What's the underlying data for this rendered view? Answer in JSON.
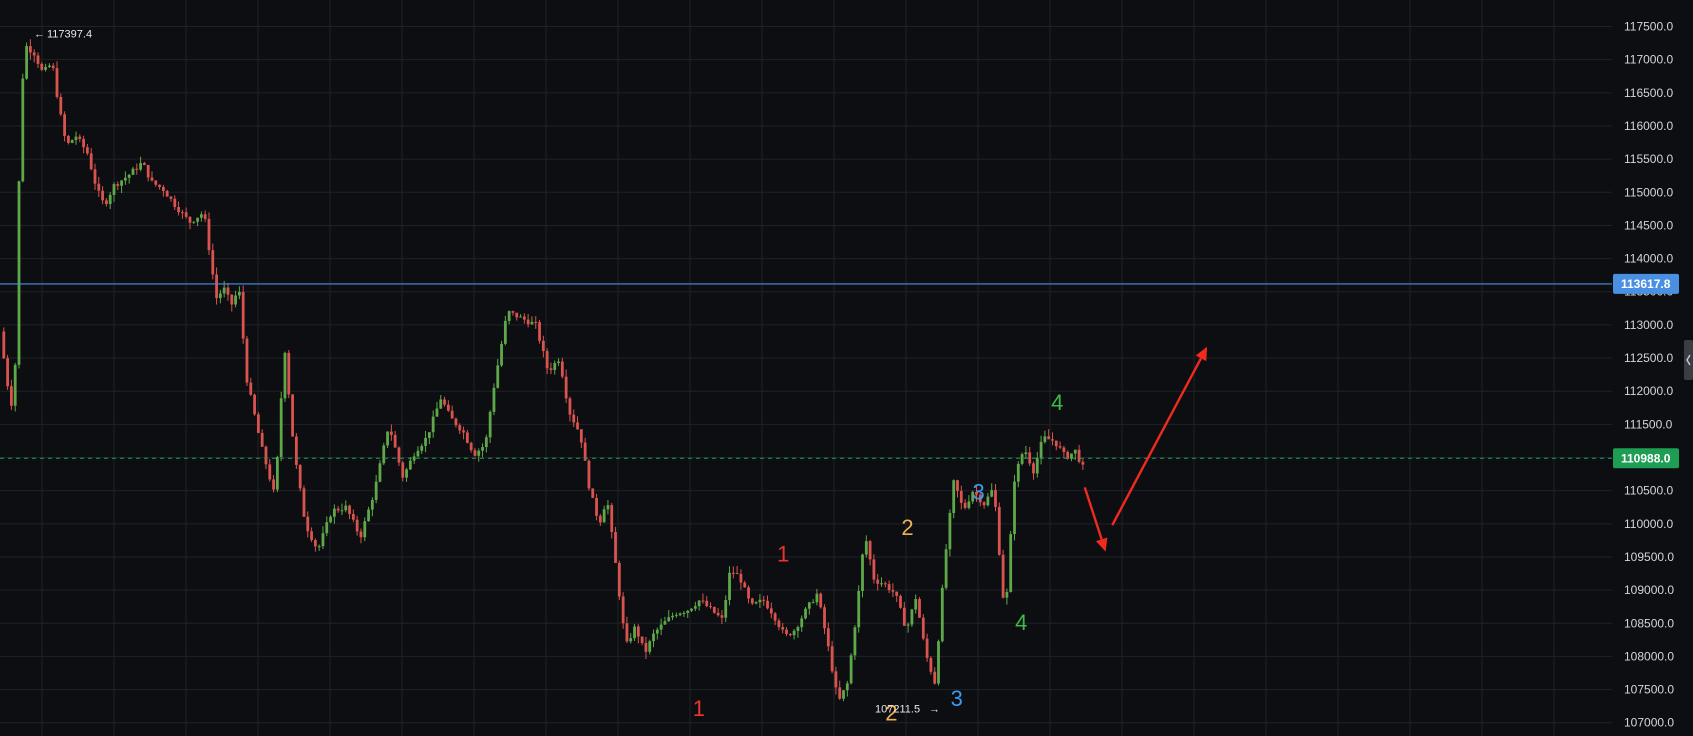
{
  "colors": {
    "background": "#0d0e11",
    "grid": "#1f2228",
    "up": "#5fa84a",
    "down": "#d9534f",
    "hline": "#4a90e2",
    "current": "#1f9d55",
    "arrow": "#f02a1e",
    "wave1": "#f0342b",
    "wave2": "#f2b155",
    "wave3": "#3a9bf0",
    "wave4": "#3fb94a"
  },
  "chart_data": {
    "type": "candlestick",
    "ylim": [
      106800,
      117900
    ],
    "y_ticks": [
      "117500.0",
      "117000.0",
      "116500.0",
      "116000.0",
      "115500.0",
      "115000.0",
      "114500.0",
      "114000.0",
      "113500.0",
      "113000.0",
      "112500.0",
      "112000.0",
      "111500.0",
      "111000.0",
      "110500.0",
      "110000.0",
      "109500.0",
      "109000.0",
      "108500.0",
      "108000.0",
      "107500.0",
      "107000.0"
    ],
    "y_tick_values": [
      117500,
      117000,
      116500,
      116000,
      115500,
      115000,
      114500,
      114000,
      113500,
      113000,
      112500,
      112000,
      111500,
      111000,
      110500,
      110000,
      109500,
      109000,
      108500,
      108000,
      107500,
      107000
    ],
    "x_range": [
      0,
      1700
    ],
    "price_path": [
      [
        0,
        112900
      ],
      [
        10,
        111900
      ],
      [
        15,
        111700
      ],
      [
        22,
        116500
      ],
      [
        28,
        117200
      ],
      [
        36,
        117100
      ],
      [
        45,
        116800
      ],
      [
        55,
        116950
      ],
      [
        62,
        116300
      ],
      [
        70,
        115700
      ],
      [
        80,
        115850
      ],
      [
        92,
        115600
      ],
      [
        102,
        115050
      ],
      [
        110,
        114800
      ],
      [
        120,
        115100
      ],
      [
        135,
        115250
      ],
      [
        150,
        115450
      ],
      [
        160,
        115150
      ],
      [
        172,
        115050
      ],
      [
        185,
        114800
      ],
      [
        200,
        114550
      ],
      [
        215,
        114700
      ],
      [
        228,
        113400
      ],
      [
        236,
        113550
      ],
      [
        244,
        113300
      ],
      [
        252,
        113550
      ],
      [
        260,
        112200
      ],
      [
        275,
        111200
      ],
      [
        290,
        110400
      ],
      [
        300,
        112700
      ],
      [
        310,
        111100
      ],
      [
        322,
        110000
      ],
      [
        335,
        109600
      ],
      [
        350,
        110200
      ],
      [
        365,
        110250
      ],
      [
        380,
        109800
      ],
      [
        395,
        110500
      ],
      [
        410,
        111500
      ],
      [
        425,
        110700
      ],
      [
        438,
        111100
      ],
      [
        450,
        111300
      ],
      [
        465,
        111900
      ],
      [
        475,
        111600
      ],
      [
        488,
        111400
      ],
      [
        500,
        111050
      ],
      [
        512,
        111200
      ],
      [
        520,
        112000
      ],
      [
        535,
        113200
      ],
      [
        550,
        113100
      ],
      [
        565,
        113000
      ],
      [
        578,
        112300
      ],
      [
        590,
        112500
      ],
      [
        600,
        111700
      ],
      [
        612,
        111350
      ],
      [
        622,
        110500
      ],
      [
        632,
        110000
      ],
      [
        640,
        110400
      ],
      [
        650,
        109300
      ],
      [
        660,
        108150
      ],
      [
        670,
        108450
      ],
      [
        680,
        108050
      ],
      [
        690,
        108350
      ],
      [
        700,
        108500
      ],
      [
        712,
        108650
      ],
      [
        725,
        108700
      ],
      [
        738,
        108850
      ],
      [
        750,
        108700
      ],
      [
        762,
        108550
      ],
      [
        770,
        109300
      ],
      [
        780,
        109200
      ],
      [
        792,
        108750
      ],
      [
        805,
        108850
      ],
      [
        815,
        108650
      ],
      [
        828,
        108300
      ],
      [
        838,
        108400
      ],
      [
        850,
        108700
      ],
      [
        862,
        108950
      ],
      [
        872,
        108250
      ],
      [
        884,
        107300
      ],
      [
        894,
        107600
      ],
      [
        904,
        108750
      ],
      [
        912,
        109850
      ],
      [
        922,
        109150
      ],
      [
        932,
        109100
      ],
      [
        944,
        108950
      ],
      [
        956,
        108400
      ],
      [
        966,
        108900
      ],
      [
        976,
        108050
      ],
      [
        986,
        107600
      ],
      [
        996,
        109400
      ],
      [
        1006,
        110650
      ],
      [
        1016,
        110200
      ],
      [
        1026,
        110500
      ],
      [
        1038,
        110300
      ],
      [
        1048,
        110550
      ],
      [
        1060,
        108550
      ],
      [
        1070,
        110700
      ],
      [
        1080,
        111150
      ],
      [
        1090,
        110800
      ],
      [
        1100,
        111300
      ],
      [
        1112,
        111250
      ],
      [
        1124,
        111000
      ],
      [
        1134,
        111100
      ],
      [
        1142,
        110850
      ]
    ],
    "candle_count": 285,
    "annotations": {
      "high_label": "117397.4",
      "high_value": 117397.4,
      "high_arrow": "←",
      "low_label": "107211.5",
      "low_value": 107211.5,
      "low_arrow": "→",
      "horizontal_line_value": 113617.8,
      "horizontal_line_label": "113617.8",
      "current_price_value": 110988.0,
      "current_price_label": "110988.0"
    },
    "wave_labels": [
      {
        "text": "1",
        "x": 737,
        "price": 107100,
        "color_key": "wave1"
      },
      {
        "text": "1",
        "x": 826,
        "price": 109430,
        "color_key": "wave1"
      },
      {
        "text": "2",
        "x": 940,
        "price": 107030,
        "color_key": "wave2"
      },
      {
        "text": "2",
        "x": 957,
        "price": 109830,
        "color_key": "wave2"
      },
      {
        "text": "3",
        "x": 1009,
        "price": 107250,
        "color_key": "wave3"
      },
      {
        "text": "3",
        "x": 1032,
        "price": 110370,
        "color_key": "wave3"
      },
      {
        "text": "4",
        "x": 1077,
        "price": 108400,
        "color_key": "wave4"
      },
      {
        "text": "4",
        "x": 1115,
        "price": 111720,
        "color_key": "wave4"
      }
    ],
    "arrows": [
      {
        "from": [
          1144,
          110550
        ],
        "to": [
          1166,
          109580
        ]
      },
      {
        "from": [
          1173,
          109980
        ],
        "to": [
          1273,
          112670
        ]
      }
    ]
  }
}
